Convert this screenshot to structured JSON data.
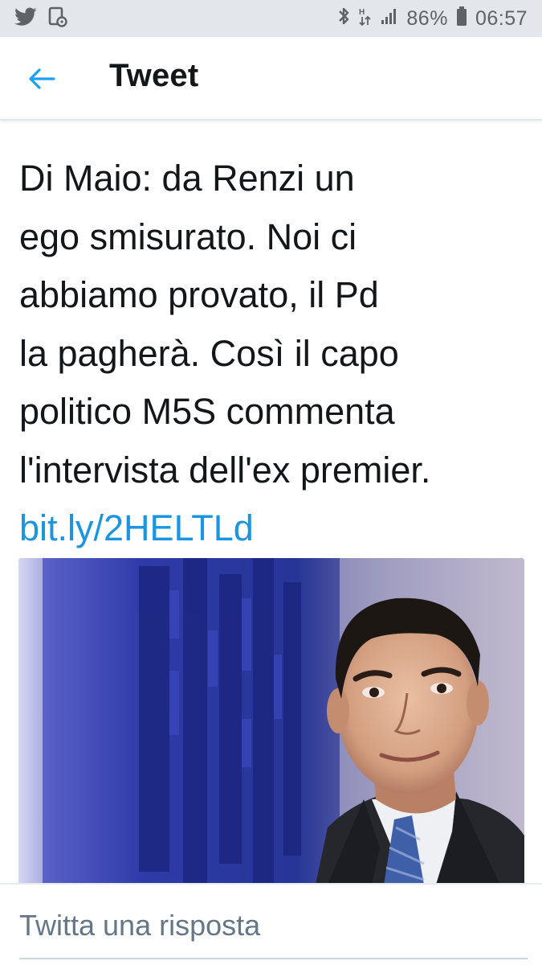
{
  "status_bar": {
    "notifications": [
      "twitter-icon",
      "screenshot-icon"
    ],
    "battery": "86%",
    "time": "06:57"
  },
  "header": {
    "title": "Tweet"
  },
  "tweet": {
    "lines": [
      "Di Maio: da Renzi un",
      "ego smisurato. Noi ci",
      "abbiamo provato, il Pd",
      "la pagherà. Così il capo",
      "politico M5S commenta",
      "l'intervista dell'ex premier."
    ],
    "link": "bit.ly/2HELTLd"
  },
  "reply": {
    "placeholder": "Twitta una risposta"
  },
  "colors": {
    "accent": "#1da1f2",
    "link": "#1b95e0",
    "text": "#14171a",
    "muted": "#657786"
  }
}
